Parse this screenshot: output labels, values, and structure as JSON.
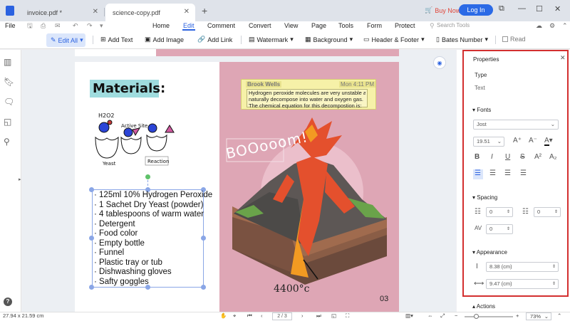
{
  "tabs": [
    {
      "label": "invoice.pdf *"
    },
    {
      "label": "science-copy.pdf"
    }
  ],
  "titlebar": {
    "buy_now": "Buy Now",
    "login": "Log In"
  },
  "menu": {
    "file": "File",
    "items": [
      "Home",
      "Edit",
      "Comment",
      "Convert",
      "View",
      "Page",
      "Tools",
      "Form",
      "Protect"
    ],
    "search_placeholder": "Search Tools"
  },
  "toolbar": {
    "edit_all": "Edit All",
    "add_text": "Add Text",
    "add_image": "Add Image",
    "add_link": "Add Link",
    "watermark": "Watermark",
    "background": "Background",
    "header_footer": "Header & Footer",
    "bates_number": "Bates Number",
    "read": "Read"
  },
  "document": {
    "materials_title": "Materials:",
    "diagram_labels": {
      "h2o2": "H2O2",
      "active_site": "Active Site",
      "yeast": "Yeast",
      "reaction": "Reaction"
    },
    "materials_list": [
      "125ml 10% Hydrogen Peroxide",
      "1 Sachet Dry Yeast (powder)",
      "4 tablespoons of warm water",
      "Detergent",
      "Food color",
      "Empty bottle",
      "Funnel",
      "Plastic tray or tub",
      "Dishwashing gloves",
      "Safty goggles"
    ],
    "note": {
      "author": "Brook Wells",
      "time": "Mon 4:11 PM",
      "lines": [
        "Hydrogen peroxide molecules are very unstable and",
        "naturally decompose into water and oxygen gas.",
        "The chemical equation for this decompostion is:"
      ]
    },
    "boom": "BOOooom!",
    "temperature": "4400°c",
    "page_number": "03"
  },
  "properties": {
    "title": "Properties",
    "type_label": "Type",
    "type_value": "Text",
    "fonts_label": "Fonts",
    "font_family": "Jost",
    "font_size": "19.51",
    "spacing_label": "Spacing",
    "line_spacing": "0",
    "paragraph_spacing": "0",
    "char_spacing": "0",
    "appearance_label": "Appearance",
    "height": "8.38 (cm)",
    "width": "9.47 (cm)",
    "actions_label": "Actions"
  },
  "status": {
    "page_size": "27.94 x 21.59 cm",
    "page_indicator": "2 / 3",
    "zoom": "73%"
  },
  "colors": {
    "accent": "#2b62e0",
    "highlight_border": "#d32f2f",
    "pink_page": "#dea6b5",
    "title_bg": "#9fdcde"
  }
}
